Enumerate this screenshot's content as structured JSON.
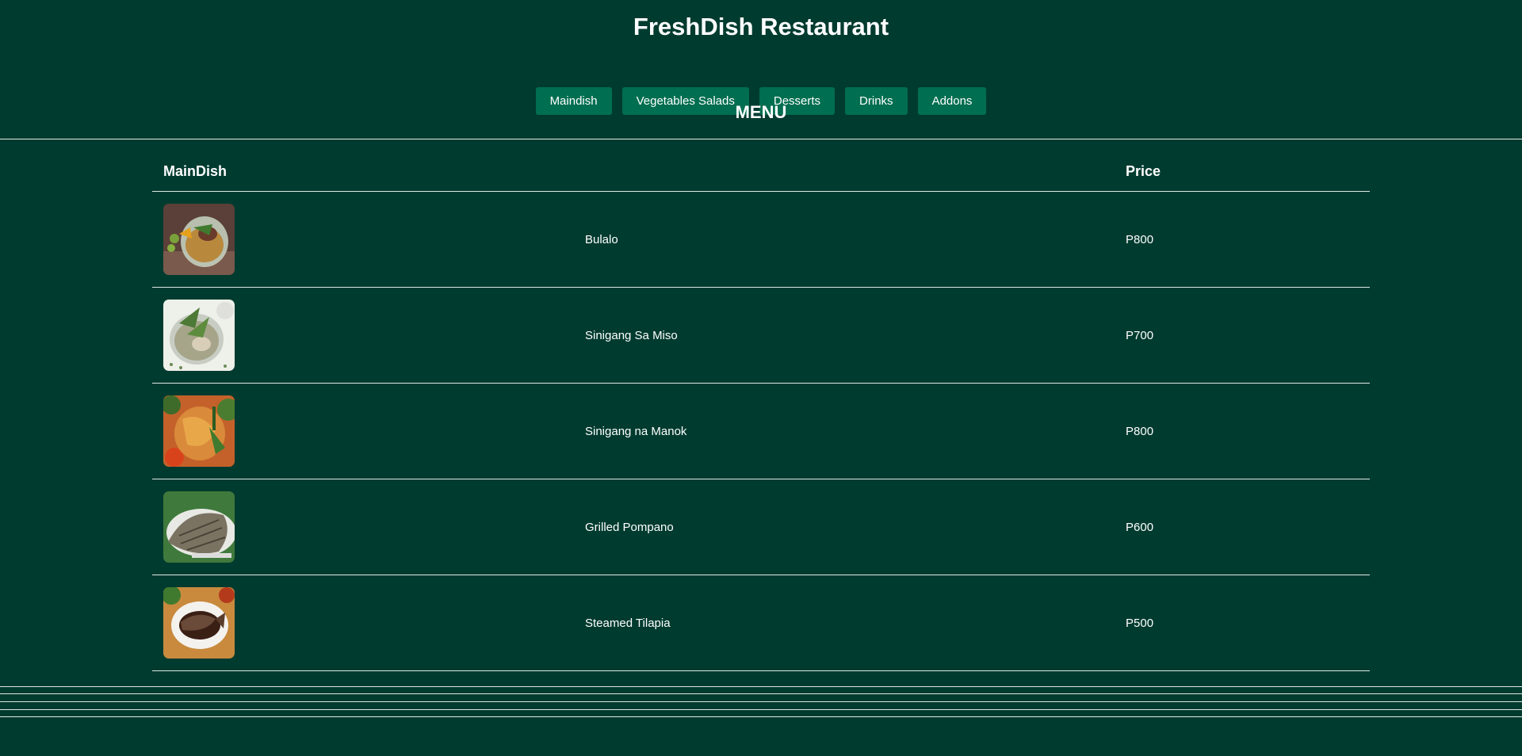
{
  "page": {
    "title": "FreshDish Restaurant",
    "menu_heading": "MENU"
  },
  "nav": {
    "items": [
      {
        "label": "Maindish"
      },
      {
        "label": "Vegetables Salads"
      },
      {
        "label": "Desserts"
      },
      {
        "label": "Drinks"
      },
      {
        "label": "Addons"
      }
    ]
  },
  "table": {
    "headers": {
      "category": "MainDish",
      "name": "",
      "price": "Price"
    },
    "rows": [
      {
        "name": "Bulalo",
        "price": "P800",
        "image": "bulalo-photo"
      },
      {
        "name": "Sinigang Sa Miso",
        "price": "P700",
        "image": "sinigang-sa-miso-photo"
      },
      {
        "name": "Sinigang na Manok",
        "price": "P800",
        "image": "sinigang-na-manok-photo"
      },
      {
        "name": "Grilled Pompano",
        "price": "P600",
        "image": "grilled-pompano-photo"
      },
      {
        "name": "Steamed Tilapia",
        "price": "P500",
        "image": "steamed-tilapia-photo"
      }
    ]
  },
  "colors": {
    "background": "#003b2f",
    "button": "#006e50",
    "text": "#ffffff",
    "divider": "#e0e8e4"
  }
}
